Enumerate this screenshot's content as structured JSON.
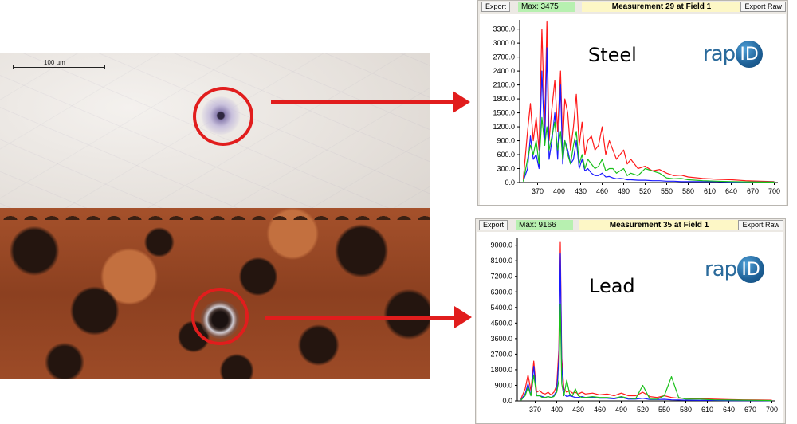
{
  "micrograph": {
    "scale_bar_label": "100 µm"
  },
  "colors": {
    "marker": "#e11d1d",
    "series_red": "#ff1a1a",
    "series_blue": "#1a1aff",
    "series_green": "#19c019"
  },
  "windows": [
    {
      "material_label": "Steel",
      "logo_text_part": "rap",
      "logo_circle_text": "ID",
      "toolbar": {
        "export_label": "Export",
        "max_label": "Max: 3475",
        "title": "Measurement 29 at Field 1",
        "export_raw_label": "Export Raw"
      }
    },
    {
      "material_label": "Lead",
      "logo_text_part": "rap",
      "logo_circle_text": "ID",
      "toolbar": {
        "export_label": "Export",
        "max_label": "Max: 9166",
        "title": "Measurement 35 at Field 1",
        "export_raw_label": "Export Raw"
      }
    }
  ],
  "chart_data": [
    {
      "type": "line",
      "title": "",
      "xlabel": "",
      "ylabel": "",
      "xlim": [
        345,
        705
      ],
      "ylim": [
        0,
        3500
      ],
      "x_ticks": [
        370,
        400,
        430,
        460,
        490,
        520,
        550,
        580,
        610,
        640,
        670,
        700
      ],
      "y_ticks": [
        0.0,
        300.0,
        600.0,
        900.0,
        1200.0,
        1500.0,
        1800.0,
        2100.0,
        2400.0,
        2700.0,
        3000.0,
        3300.0
      ],
      "series": [
        {
          "color": "red",
          "x": [
            350,
            356,
            360,
            364,
            368,
            372,
            376,
            380,
            383,
            386,
            390,
            394,
            398,
            402,
            405,
            408,
            412,
            416,
            420,
            424,
            428,
            432,
            436,
            440,
            445,
            450,
            455,
            460,
            465,
            470,
            475,
            480,
            485,
            490,
            495,
            500,
            510,
            520,
            530,
            540,
            550,
            560,
            570,
            580,
            600,
            620,
            640,
            660,
            680,
            700
          ],
          "y": [
            60,
            1100,
            1700,
            900,
            1400,
            700,
            3300,
            1200,
            3475,
            900,
            1600,
            2200,
            1100,
            2400,
            800,
            1800,
            1500,
            700,
            1200,
            1900,
            800,
            1300,
            600,
            900,
            1000,
            700,
            800,
            1200,
            600,
            900,
            700,
            500,
            600,
            700,
            400,
            500,
            300,
            350,
            250,
            280,
            200,
            150,
            160,
            120,
            90,
            70,
            60,
            40,
            30,
            20
          ]
        },
        {
          "color": "blue",
          "x": [
            350,
            356,
            360,
            364,
            368,
            372,
            376,
            380,
            383,
            386,
            390,
            394,
            398,
            402,
            405,
            408,
            412,
            416,
            420,
            424,
            428,
            432,
            436,
            440,
            445,
            450,
            455,
            460,
            465,
            470,
            475,
            480,
            485,
            490,
            495,
            500,
            510,
            520,
            530,
            540,
            550,
            560,
            570,
            580,
            600,
            620,
            640,
            660,
            680,
            700
          ],
          "y": [
            30,
            300,
            1000,
            500,
            600,
            300,
            2400,
            800,
            2900,
            500,
            900,
            1500,
            500,
            2100,
            400,
            900,
            700,
            400,
            500,
            900,
            300,
            500,
            250,
            300,
            200,
            150,
            150,
            200,
            120,
            130,
            100,
            80,
            90,
            80,
            60,
            60,
            50,
            50,
            40,
            40,
            30,
            30,
            20,
            20,
            20,
            20,
            10,
            10,
            10,
            10
          ]
        },
        {
          "color": "green",
          "x": [
            350,
            356,
            360,
            364,
            368,
            372,
            376,
            380,
            383,
            386,
            390,
            394,
            398,
            402,
            405,
            408,
            412,
            416,
            420,
            424,
            428,
            432,
            436,
            440,
            445,
            450,
            455,
            460,
            465,
            470,
            475,
            480,
            485,
            490,
            495,
            500,
            510,
            520,
            530,
            540,
            550,
            560,
            570,
            580,
            600,
            620,
            640,
            660,
            680,
            700
          ],
          "y": [
            20,
            500,
            800,
            600,
            900,
            400,
            1400,
            800,
            1200,
            700,
            1000,
            1300,
            700,
            1100,
            500,
            900,
            600,
            400,
            800,
            1100,
            400,
            600,
            300,
            500,
            400,
            300,
            350,
            500,
            250,
            300,
            300,
            200,
            250,
            300,
            150,
            200,
            150,
            300,
            250,
            200,
            100,
            80,
            90,
            60,
            40,
            30,
            20,
            15,
            10,
            10
          ]
        }
      ]
    },
    {
      "type": "line",
      "title": "",
      "xlabel": "",
      "ylabel": "",
      "xlim": [
        345,
        705
      ],
      "ylim": [
        0,
        9400
      ],
      "x_ticks": [
        370,
        400,
        430,
        460,
        490,
        520,
        550,
        580,
        610,
        640,
        670,
        700
      ],
      "y_ticks": [
        0.0,
        900.0,
        1800.0,
        2700.0,
        3600.0,
        4500.0,
        5400.0,
        6300.0,
        7200.0,
        8100.0,
        9000.0
      ],
      "series": [
        {
          "color": "red",
          "x": [
            350,
            356,
            360,
            364,
            368,
            372,
            376,
            380,
            384,
            388,
            392,
            396,
            400,
            403,
            405,
            407,
            410,
            414,
            418,
            422,
            426,
            430,
            435,
            440,
            450,
            460,
            470,
            480,
            490,
            500,
            510,
            520,
            530,
            540,
            550,
            560,
            570,
            580,
            600,
            620,
            640,
            660,
            680,
            700
          ],
          "y": [
            100,
            700,
            1500,
            600,
            2300,
            500,
            600,
            450,
            400,
            500,
            350,
            500,
            900,
            3000,
            9166,
            2500,
            700,
            500,
            600,
            450,
            500,
            400,
            500,
            400,
            450,
            350,
            400,
            300,
            450,
            300,
            300,
            500,
            250,
            200,
            300,
            200,
            150,
            150,
            120,
            100,
            80,
            60,
            50,
            40
          ]
        },
        {
          "color": "blue",
          "x": [
            350,
            356,
            360,
            364,
            368,
            372,
            376,
            380,
            384,
            388,
            392,
            396,
            400,
            403,
            405,
            407,
            410,
            414,
            418,
            422,
            426,
            430,
            435,
            440,
            450,
            460,
            470,
            480,
            490,
            500,
            510,
            520,
            530,
            540,
            550,
            560,
            570,
            580,
            600,
            620,
            640,
            660,
            680,
            700
          ],
          "y": [
            50,
            400,
            1000,
            300,
            2000,
            300,
            300,
            250,
            200,
            250,
            200,
            300,
            600,
            2400,
            8500,
            2000,
            400,
            250,
            300,
            250,
            200,
            200,
            250,
            200,
            200,
            150,
            150,
            120,
            200,
            100,
            100,
            150,
            80,
            80,
            90,
            60,
            50,
            40,
            30,
            30,
            20,
            20,
            15,
            10
          ]
        },
        {
          "color": "green",
          "x": [
            350,
            356,
            360,
            364,
            368,
            372,
            376,
            380,
            384,
            388,
            392,
            396,
            400,
            403,
            405,
            407,
            410,
            414,
            418,
            422,
            426,
            430,
            435,
            440,
            450,
            460,
            470,
            480,
            490,
            500,
            510,
            520,
            530,
            540,
            550,
            560,
            570,
            580,
            600,
            620,
            640,
            660,
            680,
            700
          ],
          "y": [
            30,
            300,
            800,
            300,
            1500,
            300,
            300,
            200,
            200,
            250,
            200,
            250,
            500,
            1200,
            5600,
            1000,
            300,
            1200,
            400,
            300,
            700,
            300,
            200,
            200,
            250,
            200,
            200,
            150,
            250,
            150,
            120,
            900,
            100,
            100,
            300,
            1400,
            200,
            100,
            100,
            60,
            50,
            40,
            30,
            20
          ]
        }
      ]
    }
  ]
}
